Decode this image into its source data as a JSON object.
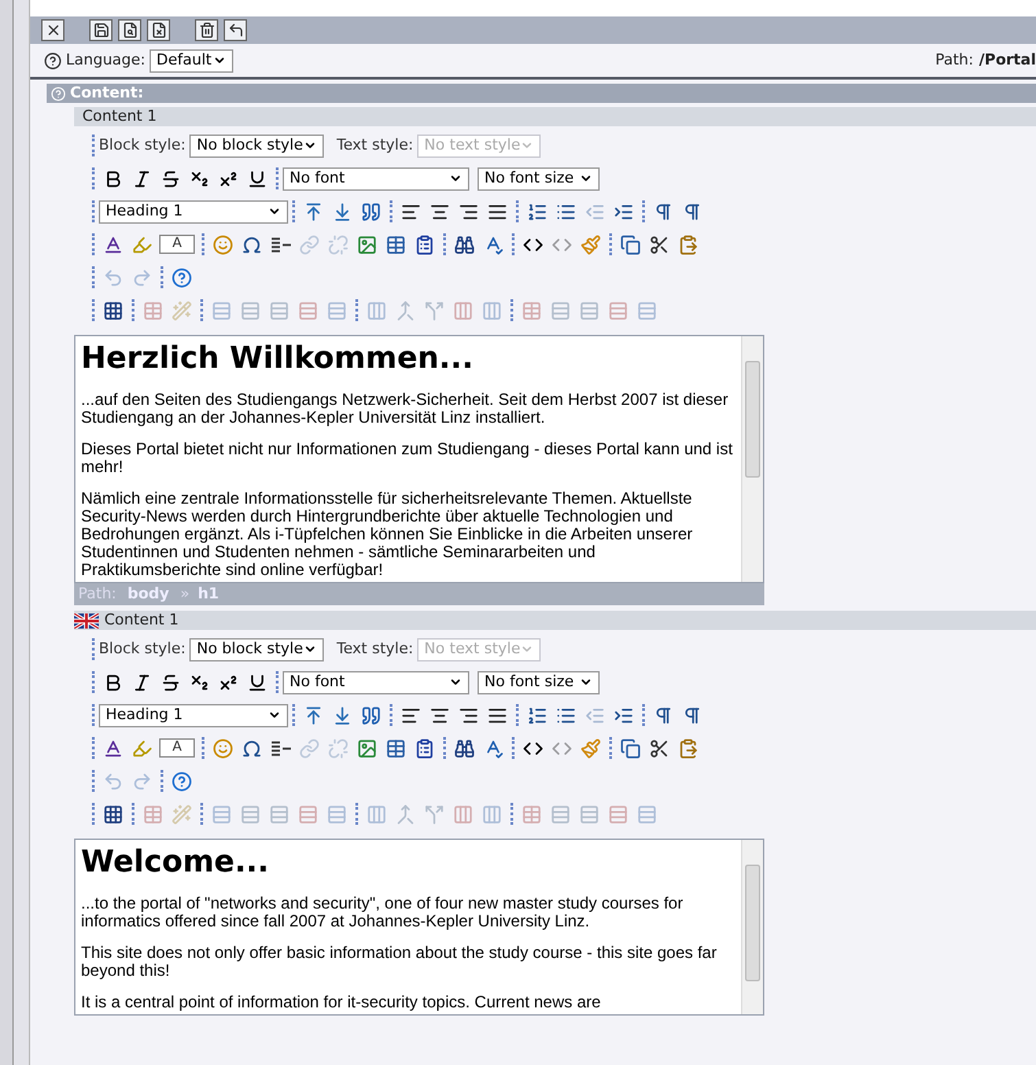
{
  "top_toolbar": [
    {
      "kind": "close"
    },
    {
      "kind": "save"
    },
    {
      "kind": "save-view"
    },
    {
      "kind": "save-close"
    },
    {
      "kind": "delete"
    },
    {
      "kind": "revert"
    }
  ],
  "language_bar": {
    "label": "Language:",
    "value": "Default",
    "path_label": "Path:",
    "path_value": "/Portal"
  },
  "section": {
    "title": "Content:"
  },
  "toolbar": [
    [
      [
        {
          "kind": "bold",
          "disabled": false
        },
        {
          "kind": "italic",
          "disabled": false
        },
        {
          "kind": "strike",
          "disabled": false
        },
        {
          "kind": "sub",
          "disabled": false
        },
        {
          "kind": "sup",
          "disabled": false
        },
        {
          "kind": "underline",
          "disabled": false
        }
      ]
    ],
    [
      [
        {
          "kind": "para-before",
          "disabled": false
        },
        {
          "kind": "para-after",
          "disabled": false
        },
        {
          "kind": "quote",
          "disabled": false
        }
      ],
      [
        {
          "kind": "align-left",
          "disabled": false
        },
        {
          "kind": "align-center",
          "disabled": false
        },
        {
          "kind": "align-right",
          "disabled": false
        },
        {
          "kind": "justify",
          "disabled": false
        }
      ],
      [
        {
          "kind": "ordered-list",
          "disabled": false
        },
        {
          "kind": "bullet-list",
          "disabled": false
        },
        {
          "kind": "outdent",
          "disabled": true
        },
        {
          "kind": "indent",
          "disabled": false
        }
      ],
      [
        {
          "kind": "ltr",
          "disabled": false
        },
        {
          "kind": "rtl",
          "disabled": false
        }
      ]
    ],
    [
      [
        {
          "kind": "text-color",
          "disabled": false
        },
        {
          "kind": "highlight",
          "disabled": false
        },
        {
          "kind": "color-box",
          "disabled": false
        }
      ],
      [
        {
          "kind": "smiley",
          "disabled": false
        },
        {
          "kind": "omega",
          "disabled": false
        },
        {
          "kind": "rule",
          "disabled": false
        },
        {
          "kind": "link",
          "disabled": true
        },
        {
          "kind": "unlink",
          "disabled": true
        },
        {
          "kind": "image",
          "disabled": false
        },
        {
          "kind": "table",
          "disabled": false
        },
        {
          "kind": "paste-list",
          "disabled": false
        }
      ],
      [
        {
          "kind": "find",
          "disabled": false
        },
        {
          "kind": "spellcheck",
          "disabled": false
        }
      ],
      [
        {
          "kind": "code",
          "disabled": false
        },
        {
          "kind": "code",
          "disabled": true
        },
        {
          "kind": "clean",
          "disabled": false
        }
      ],
      [
        {
          "kind": "copy",
          "disabled": false
        },
        {
          "kind": "cut",
          "disabled": false
        },
        {
          "kind": "paste",
          "disabled": false
        }
      ]
    ],
    [
      [
        {
          "kind": "undo",
          "disabled": true
        },
        {
          "kind": "redo",
          "disabled": true
        }
      ],
      [
        {
          "kind": "help",
          "disabled": false
        }
      ]
    ],
    [
      [
        {
          "kind": "table-grid",
          "disabled": false
        }
      ],
      [
        {
          "kind": "table-props",
          "disabled": true
        },
        {
          "kind": "wand",
          "disabled": true
        }
      ],
      [
        {
          "kind": "rows",
          "disabled": true
        },
        {
          "kind": "row-insert",
          "disabled": true
        },
        {
          "kind": "row-insert",
          "disabled": true
        },
        {
          "kind": "row-delete",
          "disabled": true
        },
        {
          "kind": "rows",
          "disabled": true
        }
      ],
      [
        {
          "kind": "columns",
          "disabled": true
        },
        {
          "kind": "merge",
          "disabled": true
        },
        {
          "kind": "split",
          "disabled": true
        },
        {
          "kind": "col-delete",
          "disabled": true
        },
        {
          "kind": "columns",
          "disabled": true
        }
      ],
      [
        {
          "kind": "table-props",
          "disabled": true
        },
        {
          "kind": "row-insert",
          "disabled": true
        },
        {
          "kind": "row-insert",
          "disabled": true
        },
        {
          "kind": "row-delete",
          "disabled": true
        },
        {
          "kind": "rows",
          "disabled": true
        }
      ]
    ]
  ],
  "editors": [
    {
      "show_flag": false,
      "title": "Content 1",
      "color_box_label": "A",
      "block_style_label": "Block style:",
      "block_style": "No block style",
      "text_style_label": "Text style:",
      "text_style": "No text style",
      "text_style_disabled": true,
      "font": "No font",
      "font_size": "No font size",
      "format": "Heading 1",
      "heading": "Herzlich Willkommen...",
      "paragraphs": [
        "...auf den Seiten des Studiengangs Netzwerk-Sicherheit. Seit dem Herbst 2007 ist dieser Studiengang an der Johannes-Kepler Universität Linz installiert.",
        "Dieses Portal bietet nicht nur Informationen zum Studiengang - dieses Portal kann und ist mehr!",
        "Nämlich eine zentrale Informationsstelle für sicherheitsrelevante Themen. Aktuellste Security-News werden durch Hintergrundberichte über aktuelle Technologien und Bedrohungen ergänzt. Als i-Tüpfelchen können Sie Einblicke in die Arbeiten unserer Studentinnen und Studenten nehmen - sämtliche Seminararbeiten und Praktikumsberichte sind online verfügbar!"
      ],
      "path": {
        "label": "Path:",
        "items": [
          "body",
          "h1"
        ],
        "separator": "»"
      }
    },
    {
      "show_flag": true,
      "title": "Content 1",
      "color_box_label": "A",
      "block_style_label": "Block style:",
      "block_style": "No block style",
      "text_style_label": "Text style:",
      "text_style": "No text style",
      "text_style_disabled": true,
      "font": "No font",
      "font_size": "No font size",
      "format": "Heading 1",
      "heading": "Welcome...",
      "paragraphs": [
        "...to the portal of \"networks and security\", one of four new master study courses for informatics offered since fall 2007 at Johannes-Kepler University Linz.",
        "This site does not only offer basic information about the study course - this site goes far beyond this!",
        "It is a central point of information for it-security topics. Current news are"
      ]
    }
  ]
}
